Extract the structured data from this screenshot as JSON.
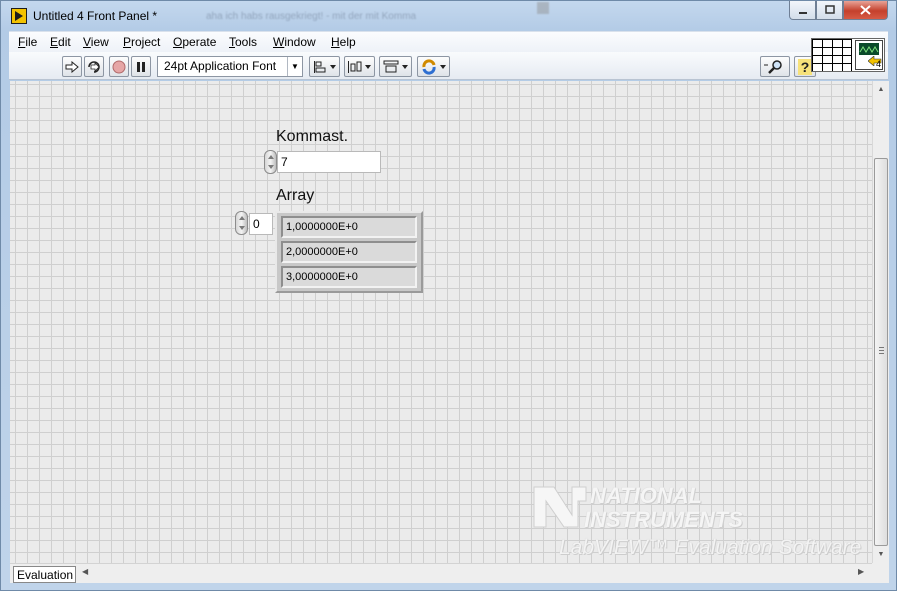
{
  "window": {
    "title": "Untitled 4 Front Panel *",
    "background_ghost_title": "aha ich habs rausgekriegt! - mit der mit Komma",
    "controls": {
      "minimize": "▭",
      "maximize": "□",
      "close": "✕"
    }
  },
  "menu": [
    {
      "label": "File",
      "hotkey": "F",
      "rest": "ile"
    },
    {
      "label": "Edit",
      "hotkey": "E",
      "rest": "dit"
    },
    {
      "label": "View",
      "hotkey": "V",
      "rest": "iew"
    },
    {
      "label": "Project",
      "hotkey": "P",
      "rest": "roject"
    },
    {
      "label": "Operate",
      "hotkey": "O",
      "rest": "perate"
    },
    {
      "label": "Tools",
      "hotkey": "T",
      "rest": "ools"
    },
    {
      "label": "Window",
      "hotkey": "W",
      "rest": "indow"
    },
    {
      "label": "Help",
      "hotkey": "H",
      "rest": "elp"
    }
  ],
  "toolbar": {
    "font_selector": "24pt Application Font",
    "icons": [
      "run-arrow-icon",
      "run-continuously-icon",
      "abort-icon",
      "pause-icon",
      "align-objects-icon",
      "distribute-objects-icon",
      "resize-objects-icon",
      "reorder-icon",
      "search-icon",
      "context-help-icon"
    ]
  },
  "connector_pane": {
    "vi_number": "4"
  },
  "panel": {
    "numeric_control": {
      "label": "Kommast.",
      "value": "7"
    },
    "array_control": {
      "label": "Array",
      "index": "0",
      "elements": [
        "1,0000000E+0",
        "2,0000000E+0",
        "3,0000000E+0"
      ]
    },
    "watermark": {
      "line1": "NATIONAL",
      "line2": "INSTRUMENTS",
      "line3": "LabVIEW™ Evaluation Software"
    }
  },
  "statusbar": {
    "evaluation_label": "Evaluation"
  },
  "colors": {
    "panel_bg": "#ebebeb",
    "grid": "#cfcfcf",
    "title_gradient": "#b3cbe6",
    "close_red": "#c4402c"
  }
}
